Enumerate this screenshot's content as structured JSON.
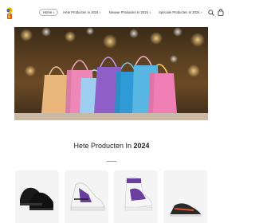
{
  "header": {
    "logo": "brand-logo",
    "nav": [
      {
        "label": "Home",
        "active": true
      },
      {
        "label": "Hete Producten In 2024",
        "active": false
      },
      {
        "label": "Nieuwe Producten In 2024",
        "active": false
      },
      {
        "label": "Speciale Producten In 2024",
        "active": false
      }
    ],
    "icons": {
      "search": "search-icon",
      "cart": "cart-icon"
    }
  },
  "hero": {
    "image": "colorful-shopping-bags"
  },
  "section": {
    "title_prefix": "Hete Producten In ",
    "title_year": "2024"
  },
  "products": [
    {
      "image": "black-sneakers"
    },
    {
      "image": "white-purple-sneaker"
    },
    {
      "image": "white-purple-high-top"
    },
    {
      "image": "black-orange-sneaker"
    }
  ],
  "colors": {
    "accent": "#6a3fa0",
    "text": "#222222"
  }
}
